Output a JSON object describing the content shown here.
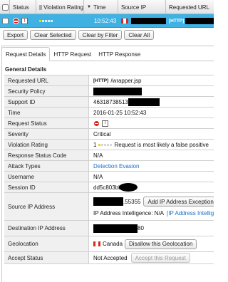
{
  "table": {
    "headers": [
      "Status",
      "Violation Rating",
      "Time",
      "Source IP",
      "Requested URL"
    ],
    "sort_icon": "sort-down-triangle-icon",
    "row": {
      "time": "10:52:43",
      "url_prefix": "[HTTP]",
      "rating_level": 1,
      "rating_max": 5
    }
  },
  "toolbar": {
    "export": "Export",
    "clear_selected": "Clear Selected",
    "clear_by_filter": "Clear by Filter",
    "clear_all": "Clear All"
  },
  "tabs": [
    "Request Details",
    "HTTP Request",
    "HTTP Response"
  ],
  "details": {
    "section_title": "General Details",
    "labels": {
      "requested_url": "Requested URL",
      "security_policy": "Security Policy",
      "support_id": "Support ID",
      "time": "Time",
      "request_status": "Request Status",
      "severity": "Severity",
      "violation_rating": "Violation Rating",
      "response_status_code": "Response Status Code",
      "attack_types": "Attack Types",
      "username": "Username",
      "session_id": "Session ID",
      "source_ip": "Source IP Address",
      "destination_ip": "Destination IP Address",
      "geolocation": "Geolocation",
      "accept_status": "Accept Status"
    },
    "values": {
      "requested_url_prefix": "[HTTP]",
      "requested_url_path": "/wrapper.jsp",
      "support_id": "46318738513",
      "time": "2016-01-25 10:52:43",
      "severity": "Critical",
      "violation_rating_num": "1",
      "violation_rating_text": "Request is most likely a false positive",
      "response_status_code": "N/A",
      "attack_types": "Detection Evasion",
      "username": "N/A",
      "session_id": "dd5c803bb",
      "source_port": ".55355",
      "add_ip_button": "Add IP Address Exception",
      "ip_intel_label": "IP Address Intelligence: N/A",
      "ip_intel_link": "[IP Address Intelligence]",
      "dest_port": "80",
      "country": "Canada",
      "disallow_geo": "Disallow this Geolocation",
      "accept_status": "Not Accepted",
      "accept_button": "Accept this Request"
    }
  },
  "colors": {
    "selected_row": "#3fb2e3",
    "link": "#1a6ec9",
    "status_red": "#d9241b"
  }
}
